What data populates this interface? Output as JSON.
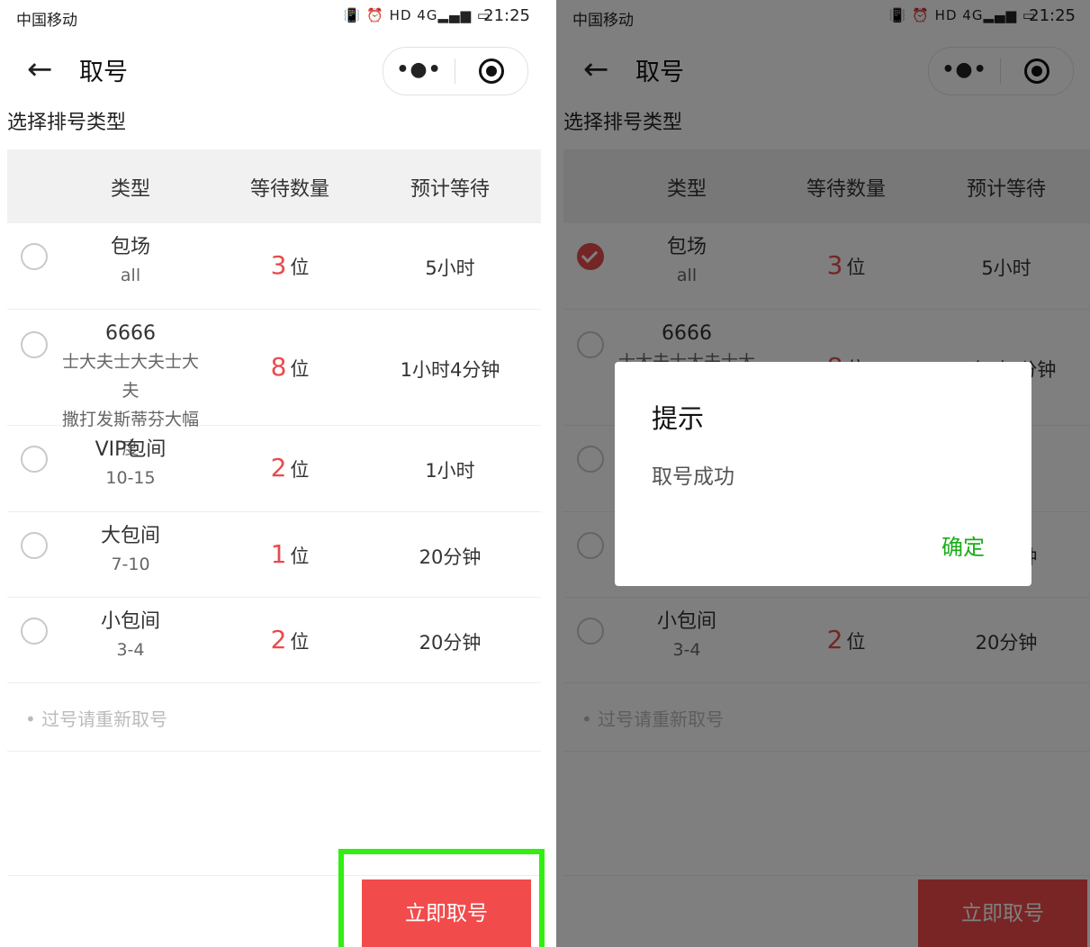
{
  "status": {
    "carrier": "中国移动",
    "status_icons": "📳 ⏰ HD 4G▂▄▆ ▭",
    "time": "21:25"
  },
  "nav": {
    "back_icon": "←",
    "title": "取号",
    "more_icon": "•●•"
  },
  "section_title": "选择排号类型",
  "table": {
    "headers": {
      "type": "类型",
      "count": "等待数量",
      "wait": "预计等待"
    },
    "rows": [
      {
        "name": "包场",
        "sub": [
          "all"
        ],
        "count": "3",
        "wait": "5小时"
      },
      {
        "name": "6666",
        "sub": [
          "士大夫士大夫士大夫",
          "撒打发斯蒂芬大幅度"
        ],
        "count": "8",
        "wait": "1小时4分钟"
      },
      {
        "name": "VIP包间",
        "sub": [
          "10-15"
        ],
        "count": "2",
        "wait": "1小时"
      },
      {
        "name": "大包间",
        "sub": [
          "7-10"
        ],
        "count": "1",
        "wait": "20分钟"
      },
      {
        "name": "小包间",
        "sub": [
          "3-4"
        ],
        "count": "2",
        "wait": "20分钟"
      }
    ],
    "count_unit": "位"
  },
  "note": "• 过号请重新取号",
  "submit_label": "立即取号",
  "dialog": {
    "title": "提示",
    "message": "取号成功",
    "confirm": "确定"
  },
  "colors": {
    "accent": "#e94a4c",
    "button": "#f24b4b",
    "confirm": "#1aad19",
    "highlight": "#33ee11"
  }
}
